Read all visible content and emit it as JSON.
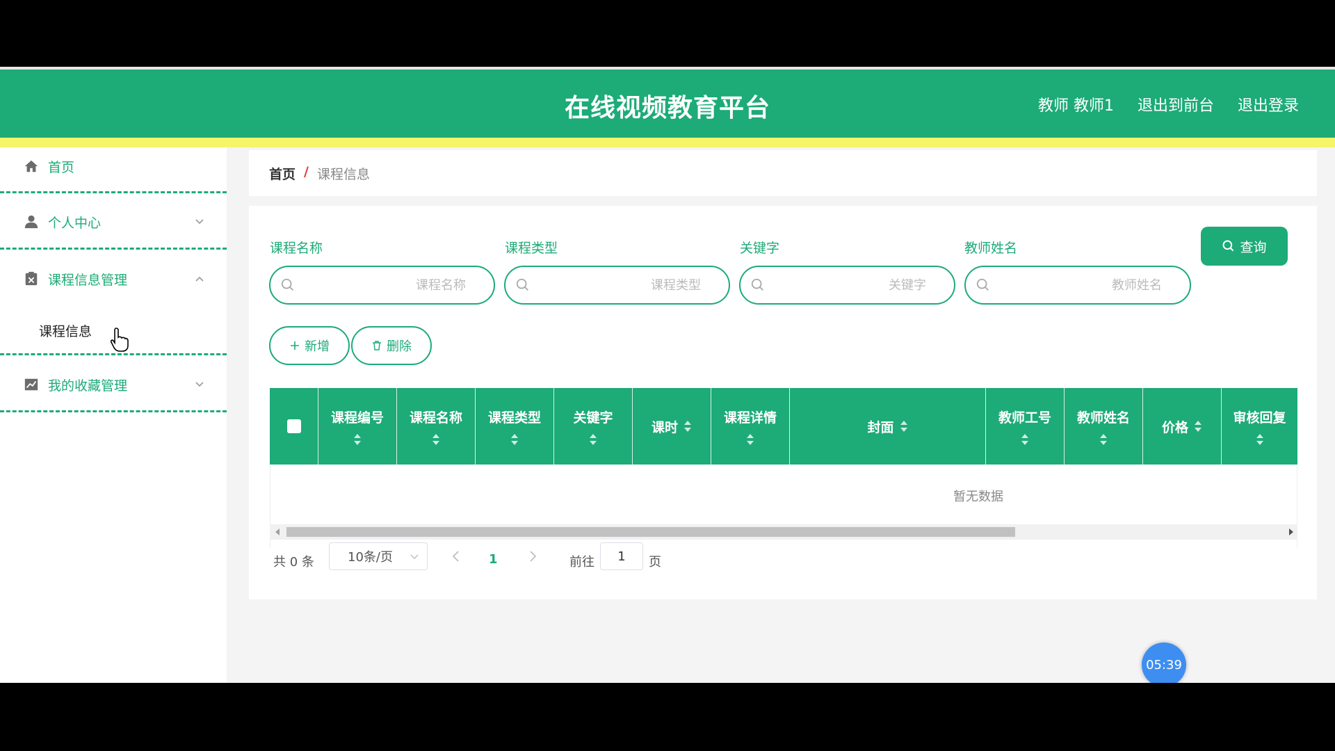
{
  "header": {
    "title": "在线视频教育平台",
    "user": "教师 教师1",
    "to_front": "退出到前台",
    "logout": "退出登录"
  },
  "sidebar": {
    "items": [
      {
        "label": "首页",
        "icon": "home-icon"
      },
      {
        "label": "个人中心",
        "icon": "user-icon"
      },
      {
        "label": "课程信息管理",
        "icon": "clipboard-icon"
      },
      {
        "label": "我的收藏管理",
        "icon": "chart-icon"
      }
    ],
    "sub_item": "课程信息"
  },
  "breadcrumb": {
    "home": "首页",
    "separator": "/",
    "current": "课程信息"
  },
  "filters": [
    {
      "label": "课程名称",
      "placeholder": "课程名称"
    },
    {
      "label": "课程类型",
      "placeholder": "课程类型"
    },
    {
      "label": "关键字",
      "placeholder": "关键字"
    },
    {
      "label": "教师姓名",
      "placeholder": "教师姓名"
    }
  ],
  "actions": {
    "query": "查询",
    "add": "新增",
    "delete": "删除"
  },
  "table": {
    "columns": [
      "课程编号",
      "课程名称",
      "课程类型",
      "关键字",
      "课时",
      "课程详情",
      "封面",
      "教师工号",
      "教师姓名",
      "价格",
      "审核回复"
    ],
    "empty_text": "暂无数据"
  },
  "pagination": {
    "total": "共 0 条",
    "page_size": "10条/页",
    "current_page": "1",
    "goto_label": "前往",
    "goto_value": "1",
    "page_suffix": "页"
  },
  "overlay": {
    "timer": "05:39"
  },
  "colors": {
    "primary": "#1dab78",
    "accent_stripe": "#f5f56a"
  }
}
